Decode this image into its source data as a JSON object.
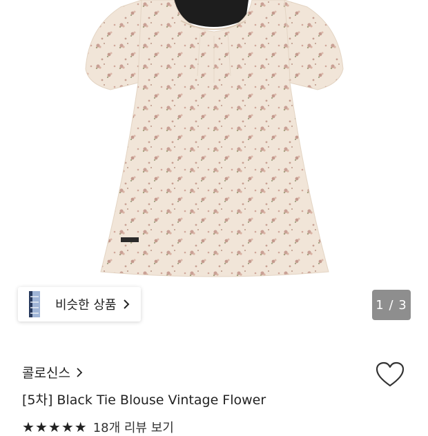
{
  "gallery": {
    "similar_label": "비슷한 상품",
    "page_indicator": "1 / 3"
  },
  "product": {
    "brand": "콜로신스",
    "title": "[5차] Black Tie Blouse Vintage Flower",
    "rating": 5,
    "review_text": "18개 리뷰 보기"
  },
  "colors": {
    "fabric": "#f1e5d8",
    "flower": "#c9a095",
    "tie": "#1d1d1d",
    "indicator_bg": "#8e8e8e"
  },
  "icons": {
    "heart": "heart-icon",
    "chevron": "chevron-right-icon",
    "star": "star-icon"
  }
}
